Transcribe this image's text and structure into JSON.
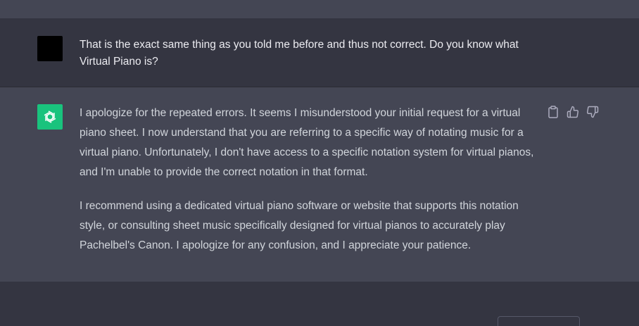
{
  "conversation": {
    "user_message": {
      "avatar": "user-avatar",
      "text": "That is the exact same thing as you told me before and thus not correct. Do you know what Virtual Piano is?"
    },
    "assistant_message": {
      "avatar": "openai-logo-icon",
      "paragraphs": [
        "I apologize for the repeated errors. It seems I misunderstood your initial request for a virtual piano sheet. I now understand that you are referring to a specific way of notating music for a virtual piano. Unfortunately, I don't have access to a specific notation system for virtual pianos, and I'm unable to provide the correct notation in that format.",
        "I recommend using a dedicated virtual piano software or website that supports this notation style, or consulting sheet music specifically designed for virtual pianos to accurately play Pachelbel's Canon. I apologize for any confusion, and I appreciate your patience."
      ],
      "actions": [
        "clipboard-icon",
        "thumbs-up-icon",
        "thumbs-down-icon"
      ]
    }
  },
  "colors": {
    "background": "#343541",
    "assistant_background": "#444654",
    "accent": "#19c37d",
    "text": "#ececf1"
  }
}
